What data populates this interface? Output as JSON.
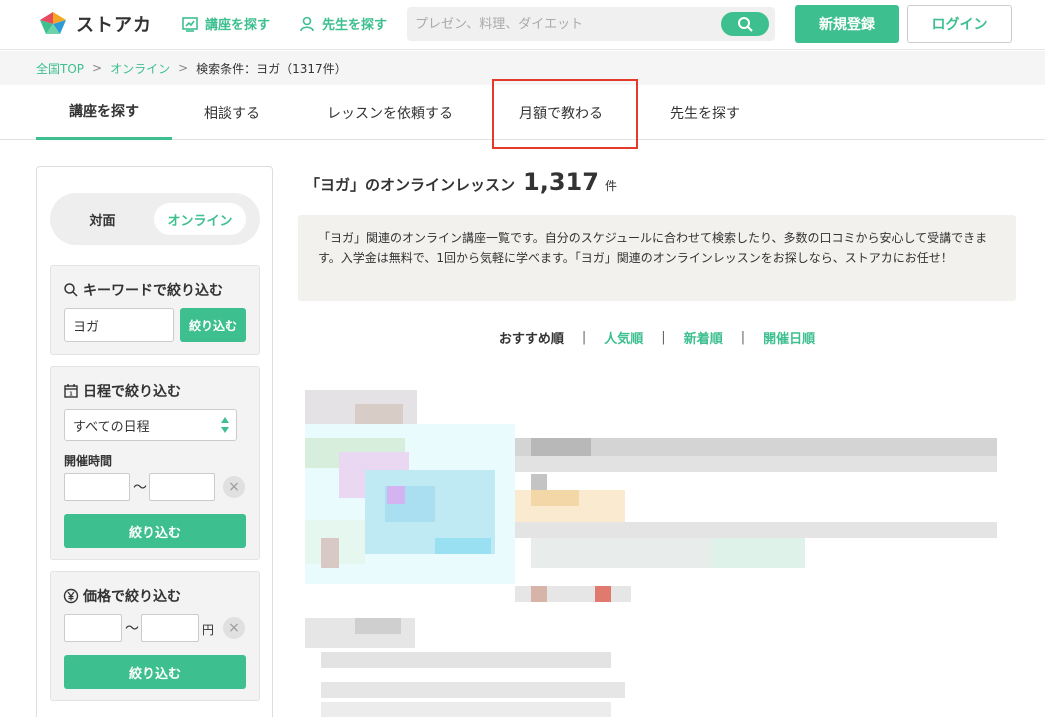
{
  "header": {
    "logo_text": "ストアカ",
    "nav_courses": "講座を探す",
    "nav_teachers": "先生を探す",
    "search_placeholder": "プレゼン、料理、ダイエット",
    "register_label": "新規登録",
    "login_label": "ログイン"
  },
  "breadcrumb": {
    "items": [
      "全国TOP",
      "オンライン"
    ],
    "current": "検索条件：ヨガ（1317件）"
  },
  "tabs": [
    {
      "label": "講座を探す",
      "active": true
    },
    {
      "label": "相談する"
    },
    {
      "label": "レッスンを依頼する"
    },
    {
      "label": "月額で教わる"
    },
    {
      "label": "先生を探す"
    }
  ],
  "sidebar": {
    "toggle": {
      "offline": "対面",
      "online": "オンライン"
    },
    "keyword": {
      "title": "キーワードで絞り込む",
      "value": "ヨガ",
      "button": "絞り込む"
    },
    "schedule": {
      "title": "日程で絞り込む",
      "select_value": "すべての日程",
      "time_label": "開催時間",
      "tilde": "〜",
      "button": "絞り込む"
    },
    "price": {
      "title": "価格で絞り込む",
      "tilde": "〜",
      "unit": "円",
      "button": "絞り込む"
    }
  },
  "main": {
    "title": "「ヨガ」のオンラインレッスン",
    "count": "1,317",
    "count_unit": "件",
    "description": "「ヨガ」関連のオンライン講座一覧です。自分のスケジュールに合わせて検索したり、多数の口コミから安心して受講できます。入学金は無料で、1回から気軽に学べます。「ヨガ」関連のオンラインレッスンをお探しなら、ストアカにお任せ！",
    "sort": [
      {
        "label": "おすすめ順",
        "active": true
      },
      {
        "label": "人気順"
      },
      {
        "label": "新着順"
      },
      {
        "label": "開催日順"
      }
    ],
    "sort_separator": "|"
  },
  "colors": {
    "accent": "#3dbf8f",
    "highlight": "#e53a2a"
  }
}
